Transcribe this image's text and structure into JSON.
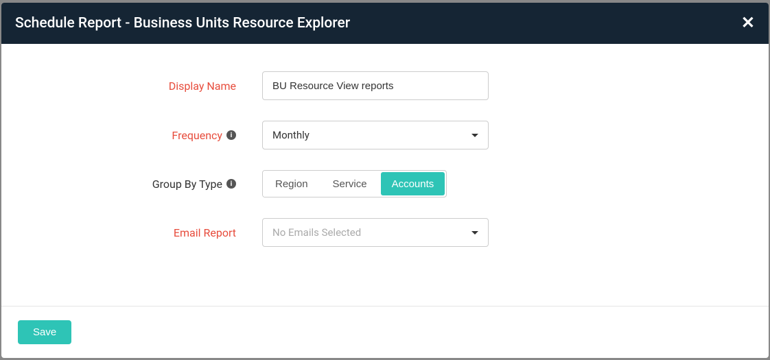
{
  "modal": {
    "title": "Schedule Report - Business Units Resource Explorer"
  },
  "form": {
    "displayName": {
      "label": "Display Name",
      "value": "BU Resource View reports"
    },
    "frequency": {
      "label": "Frequency",
      "value": "Monthly"
    },
    "groupByType": {
      "label": "Group By Type",
      "options": {
        "region": "Region",
        "service": "Service",
        "accounts": "Accounts"
      },
      "selected": "accounts"
    },
    "emailReport": {
      "label": "Email Report",
      "placeholder": "No Emails Selected"
    }
  },
  "footer": {
    "saveLabel": "Save"
  }
}
